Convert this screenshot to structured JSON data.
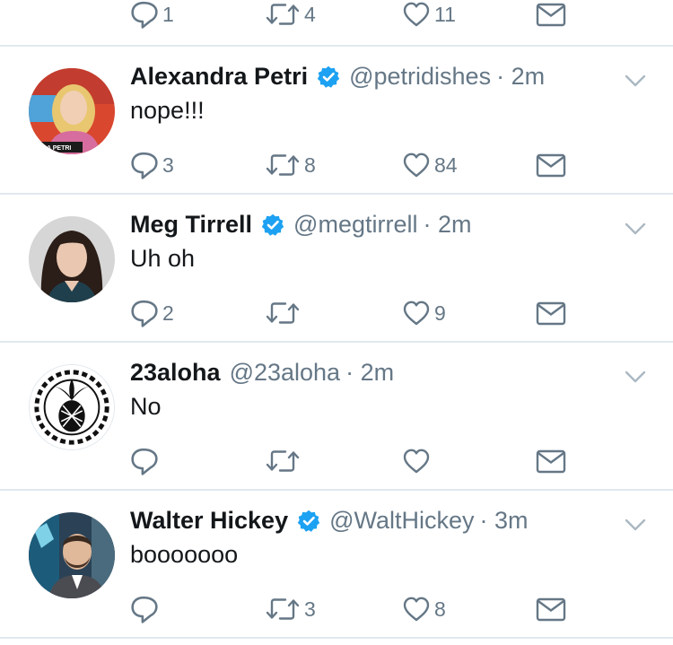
{
  "partial_tweet": {
    "reply_count": "1",
    "retweet_count": "4",
    "like_count": "11"
  },
  "tweets": [
    {
      "name": "Alexandra Petri",
      "verified": true,
      "handle": "@petridishes",
      "time": "· 2m",
      "text": "nope!!!",
      "reply_count": "3",
      "retweet_count": "8",
      "like_count": "84",
      "avatar_caption": "A PETRI"
    },
    {
      "name": "Meg Tirrell",
      "verified": true,
      "handle": "@megtirrell",
      "time": "· 2m",
      "text": "Uh oh",
      "reply_count": "2",
      "retweet_count": "",
      "like_count": "9"
    },
    {
      "name": "23aloha",
      "verified": false,
      "handle": "@23aloha",
      "time": "· 2m",
      "text": "No",
      "reply_count": "",
      "retweet_count": "",
      "like_count": ""
    },
    {
      "name": "Walter Hickey",
      "verified": true,
      "handle": "@WaltHickey",
      "time": "· 3m",
      "text": "booooooo",
      "reply_count": "",
      "retweet_count": "3",
      "like_count": "8"
    }
  ],
  "colors": {
    "verified_blue": "#1da1f2",
    "icon_gray": "#657786",
    "divider": "#e1e8ed"
  },
  "icons": [
    "reply-icon",
    "retweet-icon",
    "like-icon",
    "direct-message-icon",
    "verified-badge-icon",
    "chevron-down-icon"
  ]
}
